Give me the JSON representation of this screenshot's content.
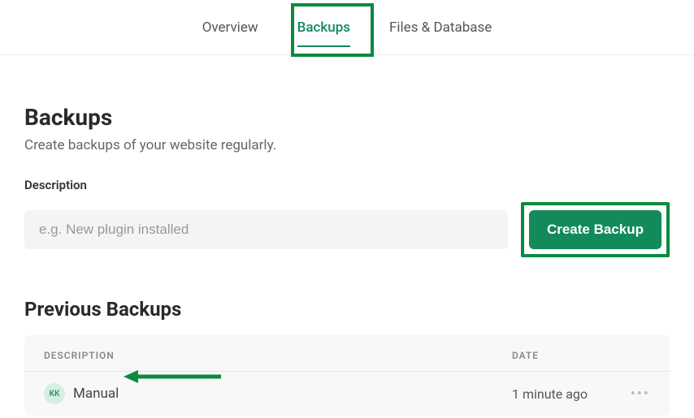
{
  "tabs": {
    "overview": "Overview",
    "backups": "Backups",
    "files_db": "Files & Database"
  },
  "page": {
    "title": "Backups",
    "subtitle": "Create backups of your website regularly."
  },
  "form": {
    "description_label": "Description",
    "description_placeholder": "e.g. New plugin installed",
    "create_button": "Create Backup"
  },
  "previous": {
    "title": "Previous Backups",
    "columns": {
      "description": "DESCRIPTION",
      "date": "DATE"
    },
    "rows": [
      {
        "avatar_initials": "KK",
        "description": "Manual",
        "date": "1 minute ago"
      }
    ]
  },
  "colors": {
    "accent": "#128a5a",
    "highlight_border": "#0a8a3f"
  }
}
